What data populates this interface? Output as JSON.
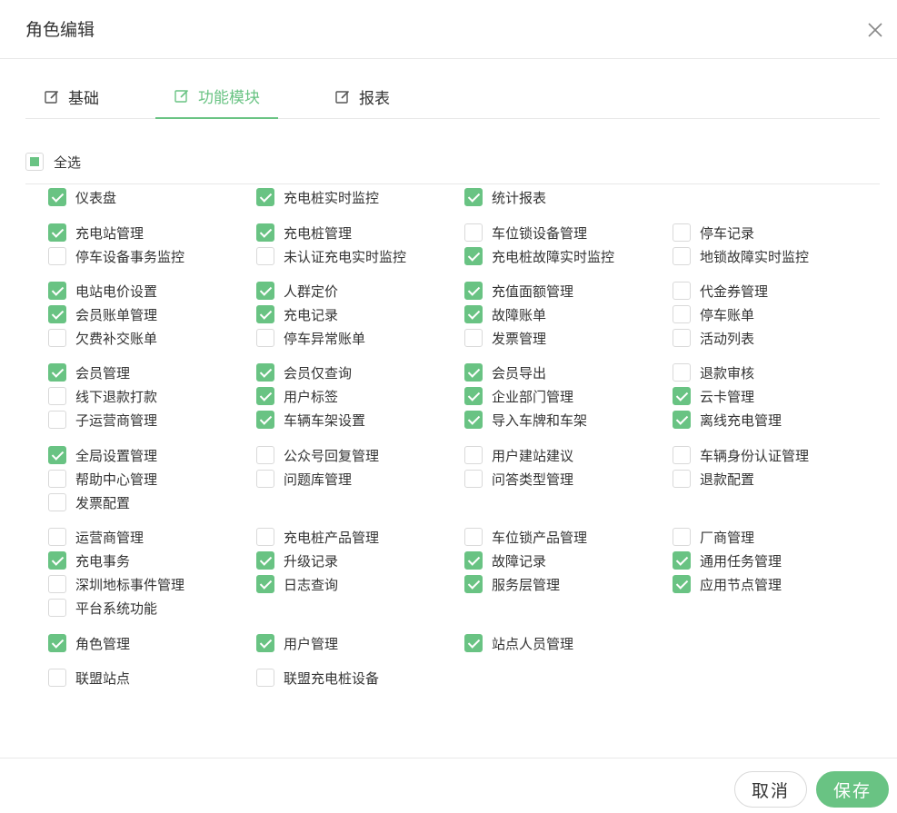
{
  "dialog": {
    "title": "角色编辑"
  },
  "tabs": [
    {
      "label": "基础"
    },
    {
      "label": "功能模块"
    },
    {
      "label": "报表"
    }
  ],
  "select_all": {
    "label": "全选",
    "state": "indeterminate"
  },
  "permissions": [
    {
      "label": "仪表盘",
      "checked": true
    },
    {
      "label": "充电桩实时监控",
      "checked": true
    },
    {
      "label": "统计报表",
      "checked": true
    },
    {
      "label": "充电站管理",
      "checked": true
    },
    {
      "label": "充电桩管理",
      "checked": true
    },
    {
      "label": "车位锁设备管理",
      "checked": false
    },
    {
      "label": "停车记录",
      "checked": false
    },
    {
      "label": "停车设备事务监控",
      "checked": false
    },
    {
      "label": "未认证充电实时监控",
      "checked": false
    },
    {
      "label": "充电桩故障实时监控",
      "checked": true
    },
    {
      "label": "地锁故障实时监控",
      "checked": false
    },
    {
      "label": "电站电价设置",
      "checked": true
    },
    {
      "label": "人群定价",
      "checked": true
    },
    {
      "label": "充值面额管理",
      "checked": true
    },
    {
      "label": "代金券管理",
      "checked": false
    },
    {
      "label": "会员账单管理",
      "checked": true
    },
    {
      "label": "充电记录",
      "checked": true
    },
    {
      "label": "故障账单",
      "checked": true
    },
    {
      "label": "停车账单",
      "checked": false
    },
    {
      "label": "欠费补交账单",
      "checked": false
    },
    {
      "label": "停车异常账单",
      "checked": false
    },
    {
      "label": "发票管理",
      "checked": false
    },
    {
      "label": "活动列表",
      "checked": false
    },
    {
      "label": "会员管理",
      "checked": true
    },
    {
      "label": "会员仅查询",
      "checked": true
    },
    {
      "label": "会员导出",
      "checked": true
    },
    {
      "label": "退款审核",
      "checked": false
    },
    {
      "label": "线下退款打款",
      "checked": false
    },
    {
      "label": "用户标签",
      "checked": true
    },
    {
      "label": "企业部门管理",
      "checked": true
    },
    {
      "label": "云卡管理",
      "checked": true
    },
    {
      "label": "子运营商管理",
      "checked": false
    },
    {
      "label": "车辆车架设置",
      "checked": true
    },
    {
      "label": "导入车牌和车架",
      "checked": true
    },
    {
      "label": "离线充电管理",
      "checked": true
    },
    {
      "label": "全局设置管理",
      "checked": true
    },
    {
      "label": "公众号回复管理",
      "checked": false
    },
    {
      "label": "用户建站建议",
      "checked": false
    },
    {
      "label": "车辆身份认证管理",
      "checked": false
    },
    {
      "label": "帮助中心管理",
      "checked": false
    },
    {
      "label": "问题库管理",
      "checked": false
    },
    {
      "label": "问答类型管理",
      "checked": false
    },
    {
      "label": "退款配置",
      "checked": false
    },
    {
      "label": "发票配置",
      "checked": false
    },
    {
      "label": "运营商管理",
      "checked": false
    },
    {
      "label": "充电桩产品管理",
      "checked": false
    },
    {
      "label": "车位锁产品管理",
      "checked": false
    },
    {
      "label": "厂商管理",
      "checked": false
    },
    {
      "label": "充电事务",
      "checked": true
    },
    {
      "label": "升级记录",
      "checked": true
    },
    {
      "label": "故障记录",
      "checked": true
    },
    {
      "label": "通用任务管理",
      "checked": true
    },
    {
      "label": "深圳地标事件管理",
      "checked": false
    },
    {
      "label": "日志查询",
      "checked": true
    },
    {
      "label": "服务层管理",
      "checked": true
    },
    {
      "label": "应用节点管理",
      "checked": true
    },
    {
      "label": "平台系统功能",
      "checked": false
    },
    {
      "label": "角色管理",
      "checked": true
    },
    {
      "label": "用户管理",
      "checked": true
    },
    {
      "label": "站点人员管理",
      "checked": true
    },
    {
      "label": "联盟站点",
      "checked": false
    },
    {
      "label": "联盟充电桩设备",
      "checked": false
    }
  ],
  "footer": {
    "cancel_label": "取消",
    "save_label": "保存"
  },
  "colors": {
    "accent": "#69c383",
    "border": "#d9d9d9",
    "divider": "#e8e8e8",
    "text": "#333333"
  }
}
